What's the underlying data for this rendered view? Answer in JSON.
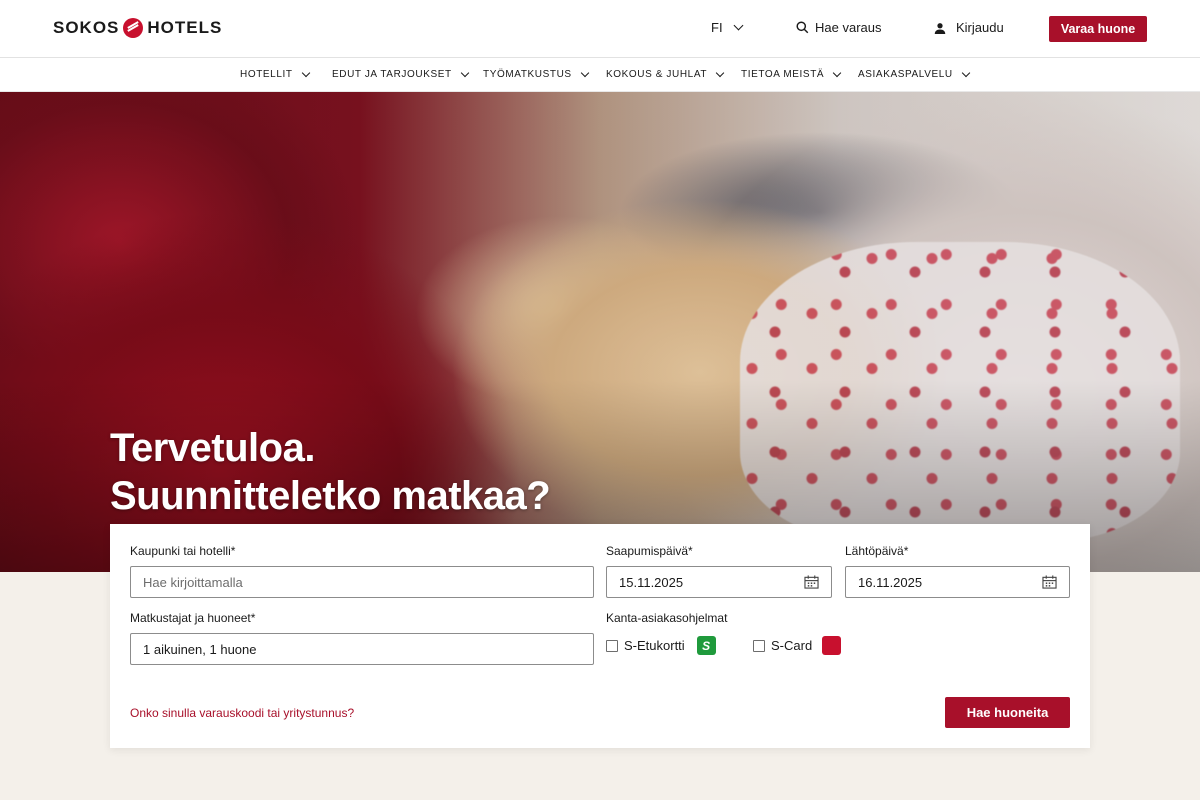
{
  "header": {
    "logo_text_left": "SOKOS",
    "logo_text_right": "HOTELS",
    "language": "FI",
    "search_booking": "Hae varaus",
    "login": "Kirjaudu",
    "book_room": "Varaa huone",
    "accent_color": "#a8102a"
  },
  "nav": {
    "items": [
      {
        "label": "HOTELLIT"
      },
      {
        "label": "EDUT JA TARJOUKSET"
      },
      {
        "label": "TYÖMATKUSTUS"
      },
      {
        "label": "KOKOUS & JUHLAT"
      },
      {
        "label": "TIETOA MEISTÄ"
      },
      {
        "label": "ASIAKASPALVELU"
      }
    ]
  },
  "hero": {
    "title_line1": "Tervetuloa.",
    "title_line2": "Suunnitteletko matkaa?"
  },
  "booking": {
    "destination_label": "Kaupunki tai hotelli*",
    "destination_placeholder": "Hae kirjoittamalla",
    "arrival_label": "Saapumispäivä*",
    "arrival_value": "15.11.2025",
    "departure_label": "Lähtöpäivä*",
    "departure_value": "16.11.2025",
    "guests_label": "Matkustajat ja huoneet*",
    "guests_value": "1 aikuinen, 1 huone",
    "loyalty_label": "Kanta-asiakasohjelmat",
    "loyalty_options": [
      {
        "label": "S-Etukortti",
        "checked": false
      },
      {
        "label": "S-Card",
        "checked": false
      }
    ],
    "promo_link": "Onko sinulla varauskoodi tai yritystunnus?",
    "search_button": "Hae huoneita"
  }
}
